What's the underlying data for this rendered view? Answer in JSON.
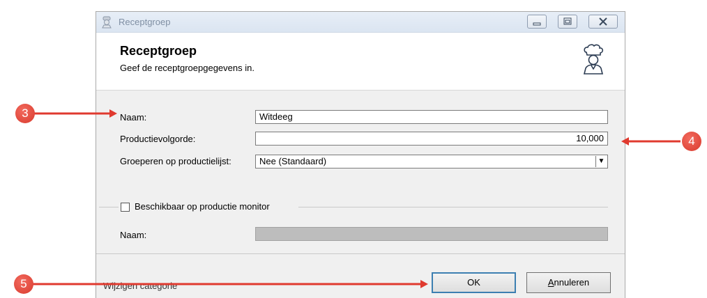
{
  "window": {
    "title": "Receptgroep",
    "controls": [
      "minimize",
      "restore",
      "close"
    ]
  },
  "header": {
    "title": "Receptgroep",
    "subtitle": "Geef de receptgroepgegevens in."
  },
  "form": {
    "naam_label": "Naam:",
    "naam_value": "Witdeeg",
    "volgorde_label": "Productievolgorde:",
    "volgorde_value": "10,000",
    "groeperen_label": "Groeperen op productielijst:",
    "groeperen_value": "Nee (Standaard)",
    "monitor_checkbox_label": "Beschikbaar op productie monitor",
    "monitor_checked": false,
    "monitor_naam_label": "Naam:",
    "monitor_naam_value": ""
  },
  "footer": {
    "status_text": "Wijzigen categorie",
    "ok_label": "OK",
    "cancel_label": "Annuleren"
  },
  "annotations": {
    "badge_3": "3",
    "badge_4": "4",
    "badge_5": "5",
    "color": "#e03a2f"
  }
}
